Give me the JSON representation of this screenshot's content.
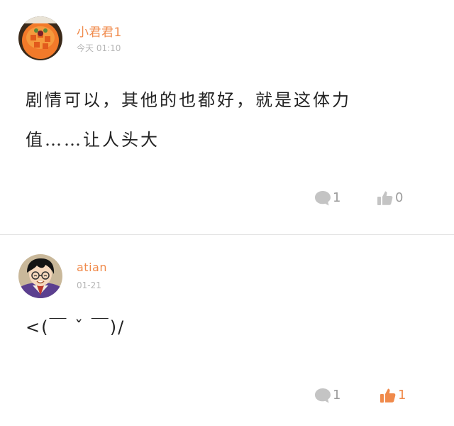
{
  "colors": {
    "accent": "#f08a4b",
    "muted": "#b5b5b5",
    "icon_gray": "#c4c4c4",
    "text": "#222222"
  },
  "comments": [
    {
      "username": "小君君1",
      "time": "今天 01:10",
      "text": "剧情可以，其他的也都好，就是这体力\n值……让人头大",
      "reply_count": "1",
      "like_count": "0",
      "liked": false,
      "avatar_icon": "food-avatar-icon"
    },
    {
      "username": "atian",
      "time": "01-21",
      "text": "<(￣ ˇ ￣)/",
      "reply_count": "1",
      "like_count": "1",
      "liked": true,
      "avatar_icon": "anime-boy-avatar-icon"
    }
  ]
}
